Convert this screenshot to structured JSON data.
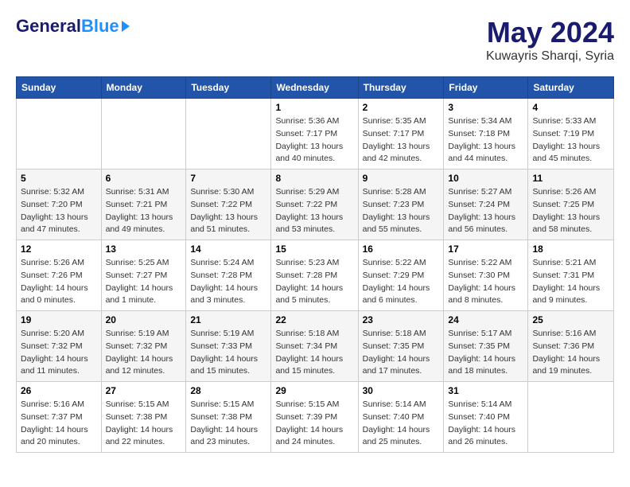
{
  "header": {
    "logo_general": "General",
    "logo_blue": "Blue",
    "month_year": "May 2024",
    "location": "Kuwayris Sharqi, Syria"
  },
  "days_of_week": [
    "Sunday",
    "Monday",
    "Tuesday",
    "Wednesday",
    "Thursday",
    "Friday",
    "Saturday"
  ],
  "weeks": [
    [
      {
        "day": "",
        "sunrise": "",
        "sunset": "",
        "daylight": ""
      },
      {
        "day": "",
        "sunrise": "",
        "sunset": "",
        "daylight": ""
      },
      {
        "day": "",
        "sunrise": "",
        "sunset": "",
        "daylight": ""
      },
      {
        "day": "1",
        "sunrise": "Sunrise: 5:36 AM",
        "sunset": "Sunset: 7:17 PM",
        "daylight": "Daylight: 13 hours and 40 minutes."
      },
      {
        "day": "2",
        "sunrise": "Sunrise: 5:35 AM",
        "sunset": "Sunset: 7:17 PM",
        "daylight": "Daylight: 13 hours and 42 minutes."
      },
      {
        "day": "3",
        "sunrise": "Sunrise: 5:34 AM",
        "sunset": "Sunset: 7:18 PM",
        "daylight": "Daylight: 13 hours and 44 minutes."
      },
      {
        "day": "4",
        "sunrise": "Sunrise: 5:33 AM",
        "sunset": "Sunset: 7:19 PM",
        "daylight": "Daylight: 13 hours and 45 minutes."
      }
    ],
    [
      {
        "day": "5",
        "sunrise": "Sunrise: 5:32 AM",
        "sunset": "Sunset: 7:20 PM",
        "daylight": "Daylight: 13 hours and 47 minutes."
      },
      {
        "day": "6",
        "sunrise": "Sunrise: 5:31 AM",
        "sunset": "Sunset: 7:21 PM",
        "daylight": "Daylight: 13 hours and 49 minutes."
      },
      {
        "day": "7",
        "sunrise": "Sunrise: 5:30 AM",
        "sunset": "Sunset: 7:22 PM",
        "daylight": "Daylight: 13 hours and 51 minutes."
      },
      {
        "day": "8",
        "sunrise": "Sunrise: 5:29 AM",
        "sunset": "Sunset: 7:22 PM",
        "daylight": "Daylight: 13 hours and 53 minutes."
      },
      {
        "day": "9",
        "sunrise": "Sunrise: 5:28 AM",
        "sunset": "Sunset: 7:23 PM",
        "daylight": "Daylight: 13 hours and 55 minutes."
      },
      {
        "day": "10",
        "sunrise": "Sunrise: 5:27 AM",
        "sunset": "Sunset: 7:24 PM",
        "daylight": "Daylight: 13 hours and 56 minutes."
      },
      {
        "day": "11",
        "sunrise": "Sunrise: 5:26 AM",
        "sunset": "Sunset: 7:25 PM",
        "daylight": "Daylight: 13 hours and 58 minutes."
      }
    ],
    [
      {
        "day": "12",
        "sunrise": "Sunrise: 5:26 AM",
        "sunset": "Sunset: 7:26 PM",
        "daylight": "Daylight: 14 hours and 0 minutes."
      },
      {
        "day": "13",
        "sunrise": "Sunrise: 5:25 AM",
        "sunset": "Sunset: 7:27 PM",
        "daylight": "Daylight: 14 hours and 1 minute."
      },
      {
        "day": "14",
        "sunrise": "Sunrise: 5:24 AM",
        "sunset": "Sunset: 7:28 PM",
        "daylight": "Daylight: 14 hours and 3 minutes."
      },
      {
        "day": "15",
        "sunrise": "Sunrise: 5:23 AM",
        "sunset": "Sunset: 7:28 PM",
        "daylight": "Daylight: 14 hours and 5 minutes."
      },
      {
        "day": "16",
        "sunrise": "Sunrise: 5:22 AM",
        "sunset": "Sunset: 7:29 PM",
        "daylight": "Daylight: 14 hours and 6 minutes."
      },
      {
        "day": "17",
        "sunrise": "Sunrise: 5:22 AM",
        "sunset": "Sunset: 7:30 PM",
        "daylight": "Daylight: 14 hours and 8 minutes."
      },
      {
        "day": "18",
        "sunrise": "Sunrise: 5:21 AM",
        "sunset": "Sunset: 7:31 PM",
        "daylight": "Daylight: 14 hours and 9 minutes."
      }
    ],
    [
      {
        "day": "19",
        "sunrise": "Sunrise: 5:20 AM",
        "sunset": "Sunset: 7:32 PM",
        "daylight": "Daylight: 14 hours and 11 minutes."
      },
      {
        "day": "20",
        "sunrise": "Sunrise: 5:19 AM",
        "sunset": "Sunset: 7:32 PM",
        "daylight": "Daylight: 14 hours and 12 minutes."
      },
      {
        "day": "21",
        "sunrise": "Sunrise: 5:19 AM",
        "sunset": "Sunset: 7:33 PM",
        "daylight": "Daylight: 14 hours and 15 minutes."
      },
      {
        "day": "22",
        "sunrise": "Sunrise: 5:18 AM",
        "sunset": "Sunset: 7:34 PM",
        "daylight": "Daylight: 14 hours and 15 minutes."
      },
      {
        "day": "23",
        "sunrise": "Sunrise: 5:18 AM",
        "sunset": "Sunset: 7:35 PM",
        "daylight": "Daylight: 14 hours and 17 minutes."
      },
      {
        "day": "24",
        "sunrise": "Sunrise: 5:17 AM",
        "sunset": "Sunset: 7:35 PM",
        "daylight": "Daylight: 14 hours and 18 minutes."
      },
      {
        "day": "25",
        "sunrise": "Sunrise: 5:16 AM",
        "sunset": "Sunset: 7:36 PM",
        "daylight": "Daylight: 14 hours and 19 minutes."
      }
    ],
    [
      {
        "day": "26",
        "sunrise": "Sunrise: 5:16 AM",
        "sunset": "Sunset: 7:37 PM",
        "daylight": "Daylight: 14 hours and 20 minutes."
      },
      {
        "day": "27",
        "sunrise": "Sunrise: 5:15 AM",
        "sunset": "Sunset: 7:38 PM",
        "daylight": "Daylight: 14 hours and 22 minutes."
      },
      {
        "day": "28",
        "sunrise": "Sunrise: 5:15 AM",
        "sunset": "Sunset: 7:38 PM",
        "daylight": "Daylight: 14 hours and 23 minutes."
      },
      {
        "day": "29",
        "sunrise": "Sunrise: 5:15 AM",
        "sunset": "Sunset: 7:39 PM",
        "daylight": "Daylight: 14 hours and 24 minutes."
      },
      {
        "day": "30",
        "sunrise": "Sunrise: 5:14 AM",
        "sunset": "Sunset: 7:40 PM",
        "daylight": "Daylight: 14 hours and 25 minutes."
      },
      {
        "day": "31",
        "sunrise": "Sunrise: 5:14 AM",
        "sunset": "Sunset: 7:40 PM",
        "daylight": "Daylight: 14 hours and 26 minutes."
      },
      {
        "day": "",
        "sunrise": "",
        "sunset": "",
        "daylight": ""
      }
    ]
  ]
}
